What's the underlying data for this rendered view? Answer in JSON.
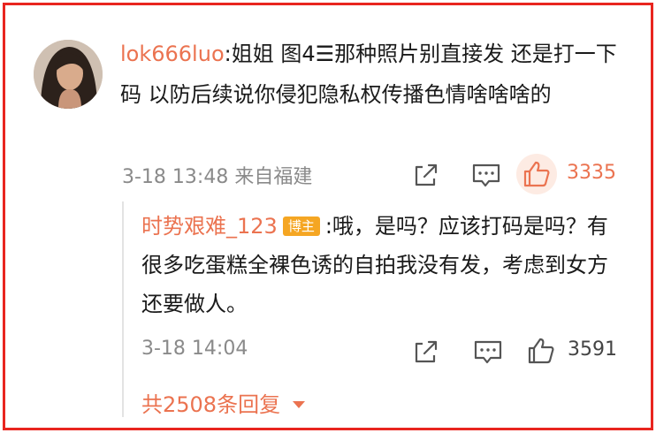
{
  "comment": {
    "username": "lok666luo",
    "separator": ":",
    "text": "姐姐 图4☰那种照片别直接发 还是打一下码 以防后续说你侵犯隐私权传播色情啥啥啥的",
    "time_source": "3-18 13:48 来自福建",
    "like_count": "3335"
  },
  "reply": {
    "username": "时势艰难_123",
    "badge": "博主",
    "text": ":哦，是吗？应该打码是吗？有很多吃蛋糕全裸色诱的自拍我没有发，考虑到女方还要做人。",
    "time": "3-18 14:04",
    "like_count": "3591"
  },
  "more_replies_label": "共2508条回复",
  "colors": {
    "accent": "#eb7350",
    "frame": "#e8251f",
    "badge": "#f5a623",
    "muted": "#8a8a8a"
  },
  "icons": [
    "share-icon",
    "comment-icon",
    "like-icon",
    "chevron-down-icon"
  ]
}
